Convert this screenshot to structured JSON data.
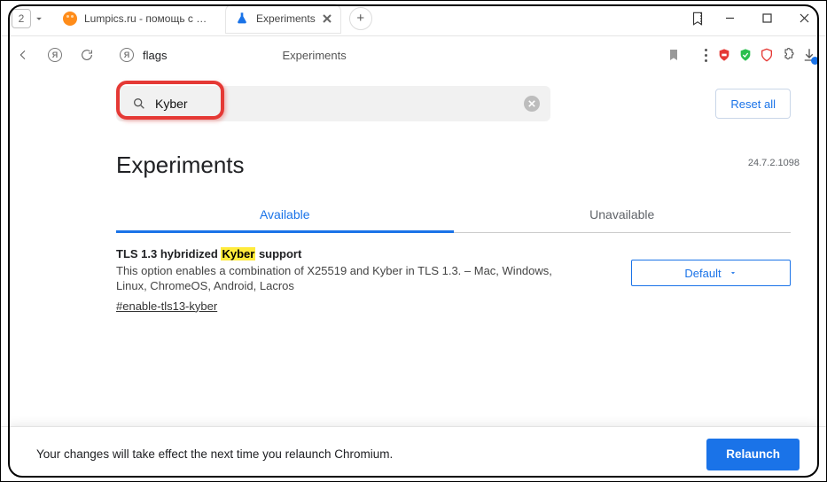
{
  "titlebar": {
    "tab_count": "2",
    "tab1_title": "Lumpics.ru - помощь с ком",
    "tab2_title": "Experiments"
  },
  "toolbar": {
    "url_label": "flags",
    "url_page_label": "Experiments"
  },
  "search": {
    "value": "Kyber"
  },
  "header": {
    "reset_label": "Reset all",
    "page_title": "Experiments",
    "version": "24.7.2.1098"
  },
  "tabs": {
    "available": "Available",
    "unavailable": "Unavailable"
  },
  "flag": {
    "title_pre": "TLS 1.3 hybridized ",
    "title_highlight": "Kyber",
    "title_post": " support",
    "desc": "This option enables a combination of X25519 and Kyber in TLS 1.3. – Mac, Windows, Linux, ChromeOS, Android, Lacros",
    "anchor": "#enable-tls13-kyber",
    "select_label": "Default"
  },
  "footer": {
    "message": "Your changes will take effect the next time you relaunch Chromium.",
    "relaunch_label": "Relaunch"
  }
}
